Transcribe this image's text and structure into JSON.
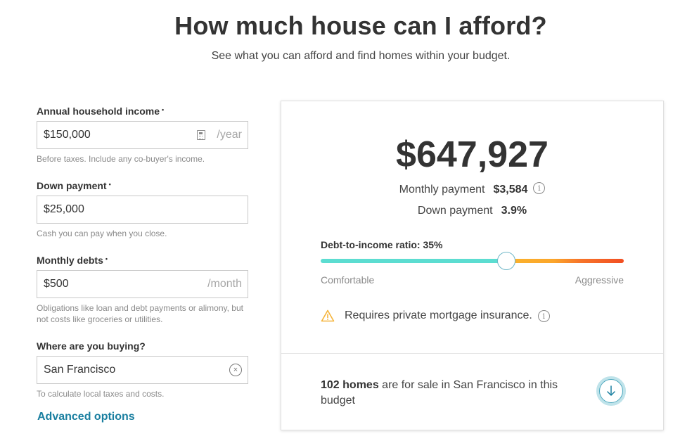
{
  "header": {
    "title": "How much house can I afford?",
    "subtitle": "See what you can afford and find homes within your budget."
  },
  "form": {
    "income": {
      "label": "Annual household income",
      "required_mark": "•",
      "value": "$150,000",
      "suffix": "/year",
      "help": "Before taxes. Include any co-buyer's income.",
      "icon": "calculator-icon"
    },
    "down_payment": {
      "label": "Down payment",
      "required_mark": "•",
      "value": "$25,000",
      "help": "Cash you can pay when you close."
    },
    "monthly_debts": {
      "label": "Monthly debts",
      "required_mark": "•",
      "value": "$500",
      "suffix": "/month",
      "help": "Obligations like loan and debt payments or alimony, but not costs like groceries or utilities."
    },
    "location": {
      "label": "Where are you buying?",
      "value": "San Francisco",
      "help": "To calculate local taxes and costs.",
      "clear_icon": "×"
    },
    "advanced_link": "Advanced options"
  },
  "result": {
    "price": "$647,927",
    "monthly_payment_label": "Monthly payment",
    "monthly_payment_value": "$3,584",
    "down_payment_label": "Down payment",
    "down_payment_value": "3.9%",
    "info_glyph": "i",
    "dti_label": "Debt-to-income ratio: 35%",
    "dti_percent": 35,
    "dti_slider_fraction": 0.613,
    "scale_left": "Comfortable",
    "scale_right": "Aggressive",
    "pmi_text": "Requires private mortgage insurance.",
    "homes_count": "102 homes",
    "homes_text": " are for sale in San Francisco in this budget",
    "colors": {
      "comfortable": "#5cddd1",
      "warning": "#fbb32d",
      "aggressive": "#f24e22",
      "link": "#1a7fa0"
    }
  }
}
